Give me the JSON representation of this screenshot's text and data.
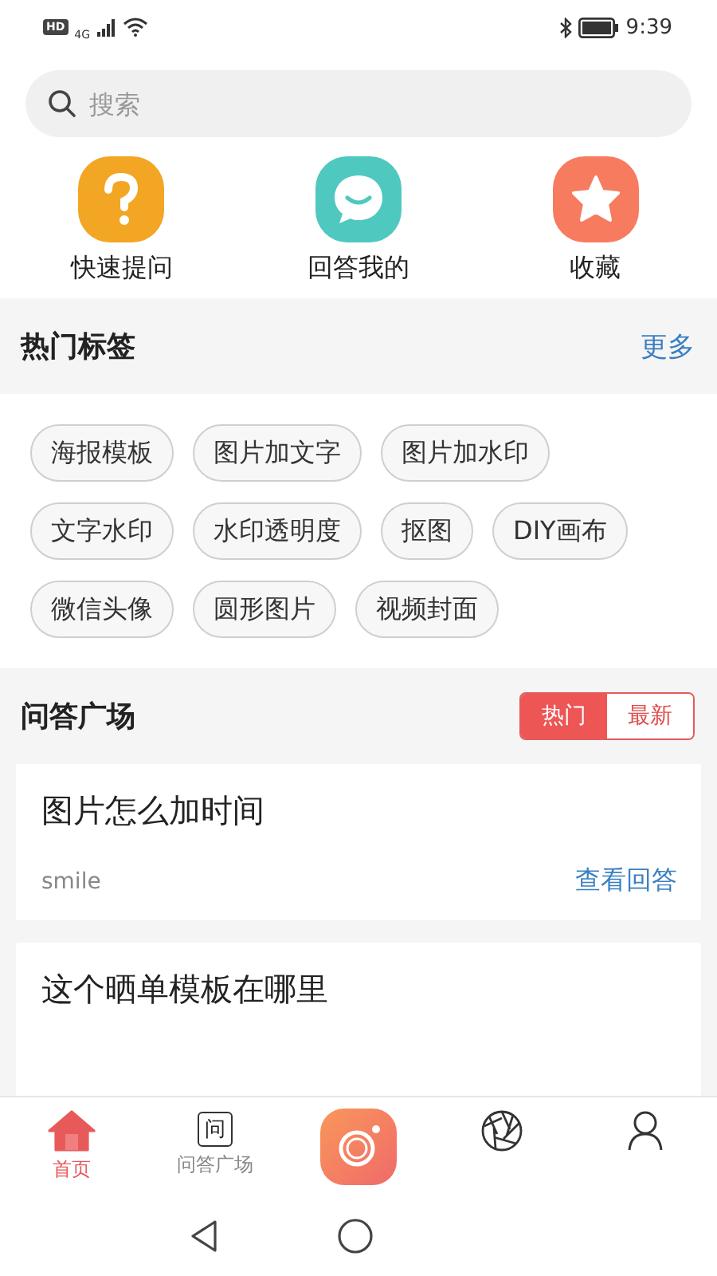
{
  "status_bar": {
    "network_badge": "HD",
    "network": "4G",
    "time": "9:39"
  },
  "search": {
    "placeholder": "搜索"
  },
  "quick_actions": [
    {
      "kind": "question",
      "label": "快速提问",
      "color": "#f2a623"
    },
    {
      "kind": "chat",
      "label": "回答我的",
      "color": "#4fc8c0"
    },
    {
      "kind": "star",
      "label": "收藏",
      "color": "#f77b5f"
    }
  ],
  "hot_tags": {
    "title": "热门标签",
    "more": "更多",
    "tags": [
      "海报模板",
      "图片加文字",
      "图片加水印",
      "文字水印",
      "水印透明度",
      "抠图",
      "DIY画布",
      "微信头像",
      "圆形图片",
      "视频封面"
    ]
  },
  "qa_square": {
    "title": "问答广场",
    "filters": [
      {
        "label": "热门",
        "selected": true
      },
      {
        "label": "最新",
        "selected": false
      }
    ],
    "cards": [
      {
        "question": "图片怎么加时间",
        "author": "smile",
        "link": "查看回答"
      },
      {
        "question": "这个晒单模板在哪里"
      }
    ]
  },
  "tab_bar": [
    {
      "kind": "home",
      "label": "首页",
      "selected": true
    },
    {
      "kind": "qa",
      "label": "问答广场",
      "icon_text": "问",
      "selected": false
    },
    {
      "kind": "camera",
      "selected": false
    },
    {
      "kind": "aperture",
      "selected": false
    },
    {
      "kind": "profile",
      "selected": false
    }
  ]
}
